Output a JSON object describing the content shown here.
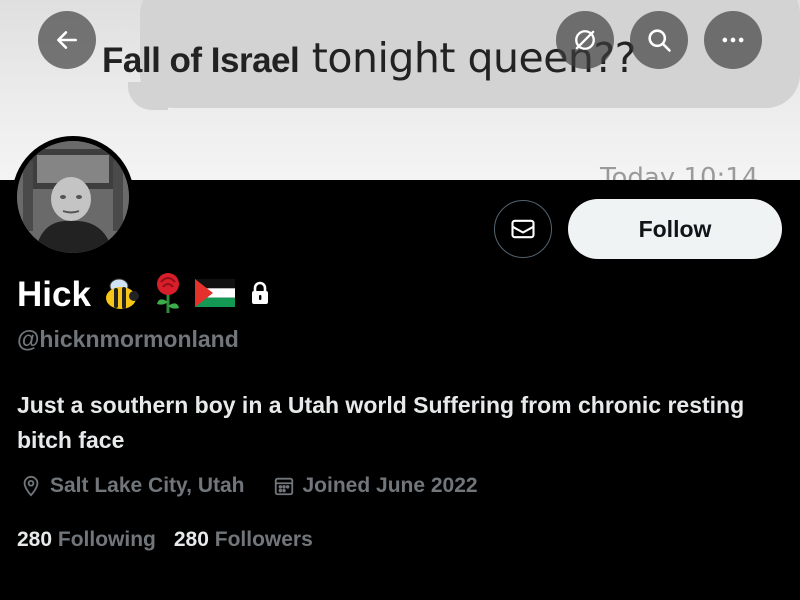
{
  "banner": {
    "text_bold": "Fall of Israel",
    "text_regular": "tonight queen??",
    "timestamp_partial": "Today 10:14"
  },
  "nav": {
    "back_icon": "arrow-left-icon",
    "hide_icon": "eye-off-icon",
    "search_icon": "search-icon",
    "more_icon": "more-horizontal-icon"
  },
  "profile": {
    "display_name": "Hick",
    "name_emojis": [
      "bee",
      "rose",
      "palestine-flag"
    ],
    "protected_icon": "lock-icon",
    "handle": "@hicknmormonland",
    "bio": "Just a southern boy in a Utah world Suffering from chronic resting bitch face",
    "location": "Salt Lake City, Utah",
    "joined": "Joined June 2022",
    "following_count": "280",
    "following_label": "Following",
    "followers_count": "280",
    "followers_label": "Followers"
  },
  "actions": {
    "message_icon": "envelope-icon",
    "follow_label": "Follow"
  },
  "colors": {
    "background": "#000000",
    "text_primary": "#e7e9ea",
    "text_secondary": "#71767b",
    "follow_bg": "#eff3f4"
  }
}
